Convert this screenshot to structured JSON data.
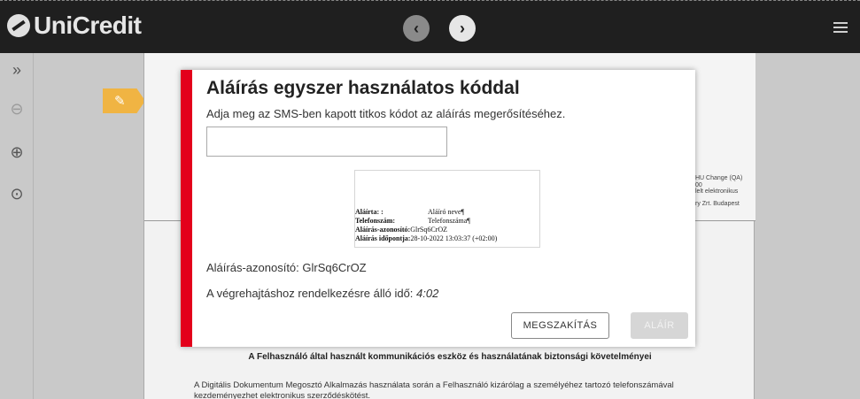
{
  "header": {
    "logo_text": "UniCredit",
    "prev_icon": "chevron-left-icon",
    "next_icon": "chevron-right-icon",
    "menu_icon": "hamburger-menu-icon"
  },
  "toolbar": {
    "items": [
      {
        "icon": "expand-sidebar-icon",
        "glyph": "»"
      },
      {
        "icon": "zoom-out-icon",
        "glyph": "⊖"
      },
      {
        "icon": "zoom-in-icon",
        "glyph": "⊕"
      },
      {
        "icon": "zoom-reset-icon",
        "glyph": "⊙"
      }
    ]
  },
  "document": {
    "side_lines": [
      "HU Change (QA)",
      "00",
      "lelt elektronikus",
      "ry Zrt. Budapest"
    ],
    "heading": "A Felhasználó által használt kommunikációs eszköz és használatának biztonsági követelményei",
    "paragraph": "A Digitális Dokumentum Megosztó Alkalmazás használata során a Felhasználó kizárólag a személyéhez tartozó telefonszámával kezdeményezhet elektronikus szerződéskötést."
  },
  "modal": {
    "title": "Aláírás egyszer használatos kóddal",
    "subtitle": "Adja meg az SMS-ben kapott titkos kódot az aláírás megerősítéséhez.",
    "code_value": "",
    "signature_preview": {
      "rows": [
        {
          "key": "Aláírta: :",
          "value": "Aláíró neve¶"
        },
        {
          "key": "Telefonszám:",
          "value": "Telefonszáma¶"
        },
        {
          "key": "Aláírás-azonosító:",
          "value": "GlrSq6CrOZ"
        },
        {
          "key": "Aláírás időpontja:",
          "value": "28-10-2022 13:03:37 (+02:00)"
        }
      ]
    },
    "signature_id_line": "Aláírás-azonosító: GlrSq6CrOZ",
    "time_label": "A végrehajtáshoz rendelkezésre álló idő: ",
    "time_value": "4:02",
    "cancel_label": "MEGSZAKÍTÁS",
    "sign_label": "ALÁÍR"
  },
  "colors": {
    "accent": "#e3001b",
    "topbar": "#1f1f1f",
    "pen_badge": "#f0b443"
  }
}
